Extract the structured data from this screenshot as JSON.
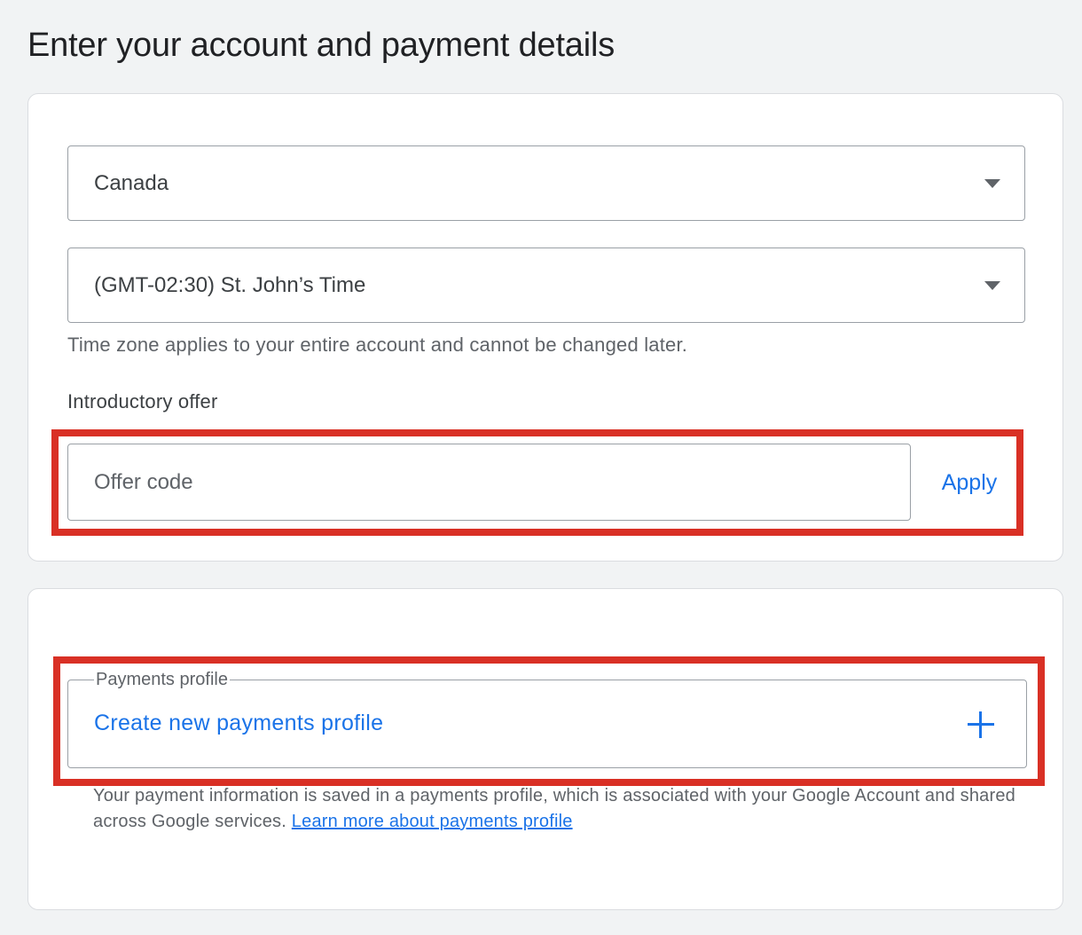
{
  "page": {
    "title": "Enter your account and payment details"
  },
  "account": {
    "country": {
      "selected": "Canada"
    },
    "timezone": {
      "selected": "(GMT-02:30) St. John’s Time",
      "helper": "Time zone applies to your entire account and cannot be changed later."
    },
    "intro_offer": {
      "label": "Introductory offer",
      "placeholder": "Offer code",
      "value": "",
      "apply_label": "Apply"
    }
  },
  "payments": {
    "legend": "Payments profile",
    "create_label": "Create new payments profile",
    "helper": "Your payment information is saved in a payments profile, which is associated with your Google Account and shared across Google services.",
    "learn_more": "Learn more about payments profile"
  },
  "colors": {
    "accent": "#1a73e8",
    "highlight": "#d93025",
    "background": "#f1f3f4"
  }
}
